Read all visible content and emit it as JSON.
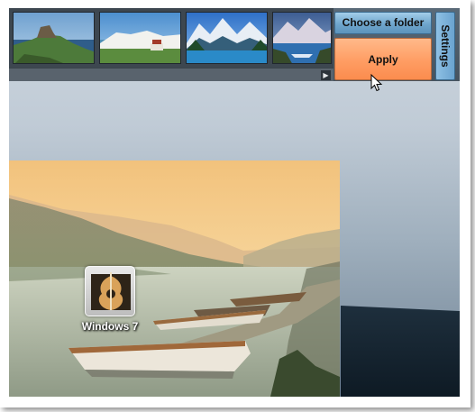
{
  "toolbar": {
    "thumbnails": [
      {
        "name": "castle-coast"
      },
      {
        "name": "white-cliffs"
      },
      {
        "name": "mountain-lake"
      },
      {
        "name": "mountain-river"
      }
    ],
    "choose_folder_label": "Choose a folder",
    "apply_label": "Apply",
    "settings_label": "Settings",
    "scroll_arrow": "▶"
  },
  "preview": {
    "desktop_icon_label": "Windows 7"
  },
  "colors": {
    "choose_button": "#7fb3d8",
    "apply_button": "#ff9d63",
    "settings_tab": "#7ab2da",
    "toolbar": "#4f5d6a"
  }
}
